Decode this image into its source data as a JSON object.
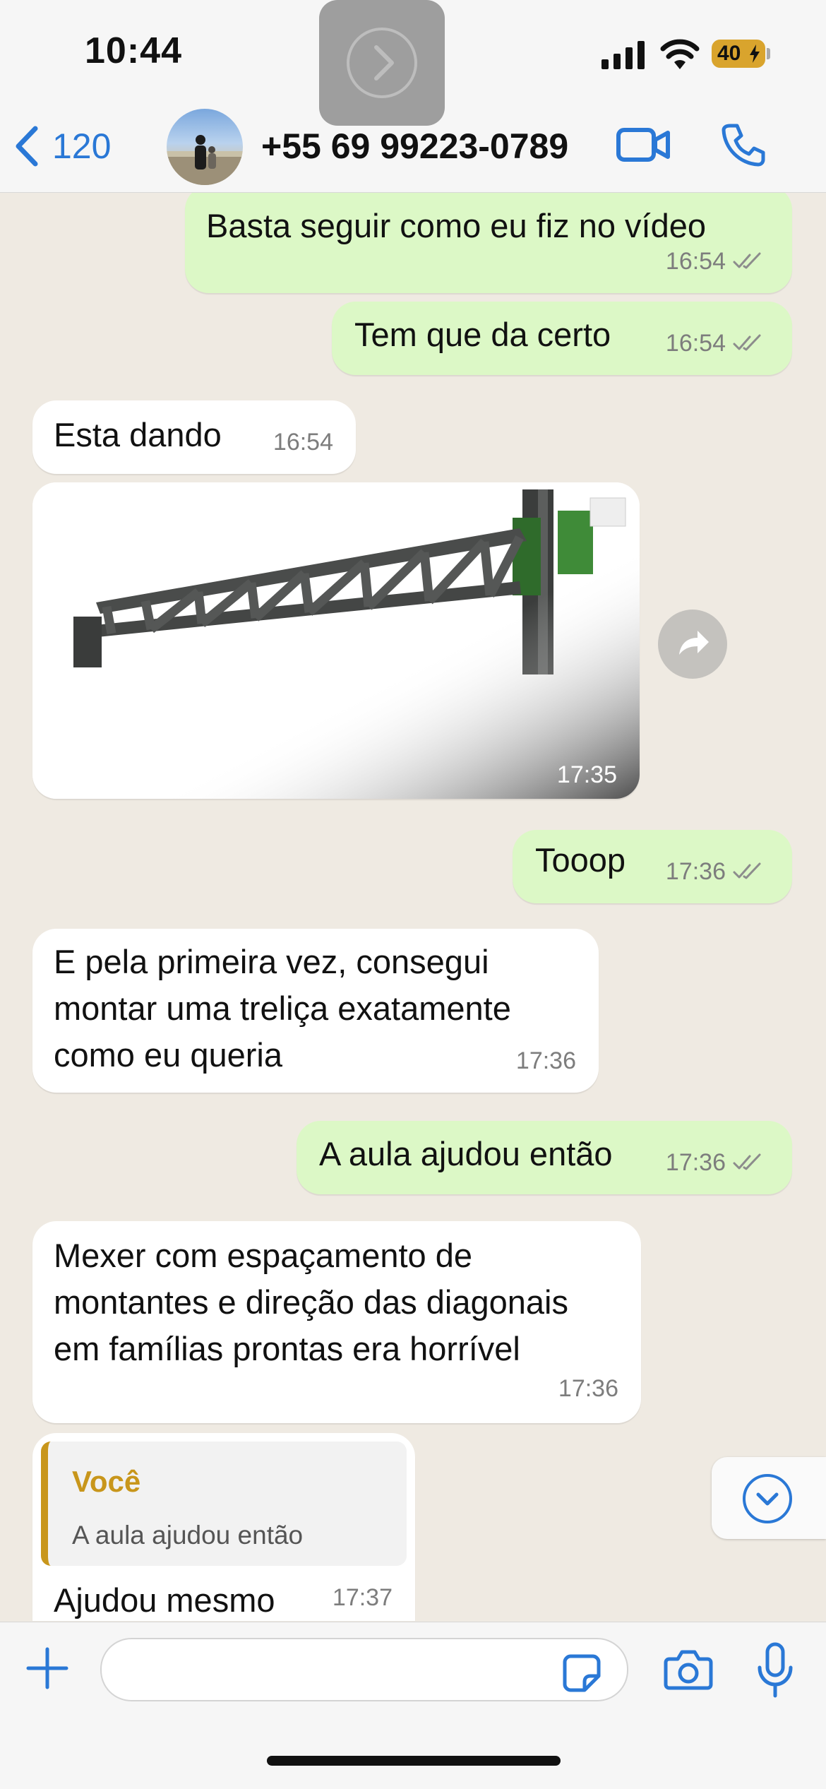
{
  "status": {
    "time": "10:44",
    "battery": "40"
  },
  "header": {
    "back_count": "120",
    "contact": "+55 69 99223-0789"
  },
  "messages": [
    {
      "dir": "out",
      "text": "Basta seguir como eu fiz no vídeo",
      "time": "16:54"
    },
    {
      "dir": "out",
      "text": "Tem que da certo",
      "time": "16:54"
    },
    {
      "dir": "in",
      "text": "Esta dando",
      "time": "16:54"
    },
    {
      "dir": "in",
      "type": "image",
      "time": "17:35"
    },
    {
      "dir": "out",
      "text": "Tooop",
      "time": "17:36"
    },
    {
      "dir": "in",
      "text": "E pela primeira vez, consegui\nmontar uma treliça exatamente\ncomo eu queria",
      "time": "17:36"
    },
    {
      "dir": "out",
      "text": "A aula ajudou então",
      "time": "17:36"
    },
    {
      "dir": "in",
      "text": "Mexer com espaçamento de\nmontantes e direção das diagonais\nem famílias prontas era horrível",
      "time": "17:36"
    },
    {
      "dir": "in",
      "quote_author": "Você",
      "quote_text": "A aula ajudou então",
      "text": "Ajudou mesmo",
      "time": "17:37"
    }
  ],
  "icons": [
    "chevron-left-icon",
    "video-call-icon",
    "phone-icon",
    "forward-icon",
    "chevron-down-icon",
    "plus-icon",
    "sticker-icon",
    "camera-icon",
    "microphone-icon"
  ],
  "colors": {
    "outgoing": "#dcf8c6",
    "incoming": "#ffffff",
    "accent": "#2a78d6",
    "quote": "#c8961b"
  }
}
